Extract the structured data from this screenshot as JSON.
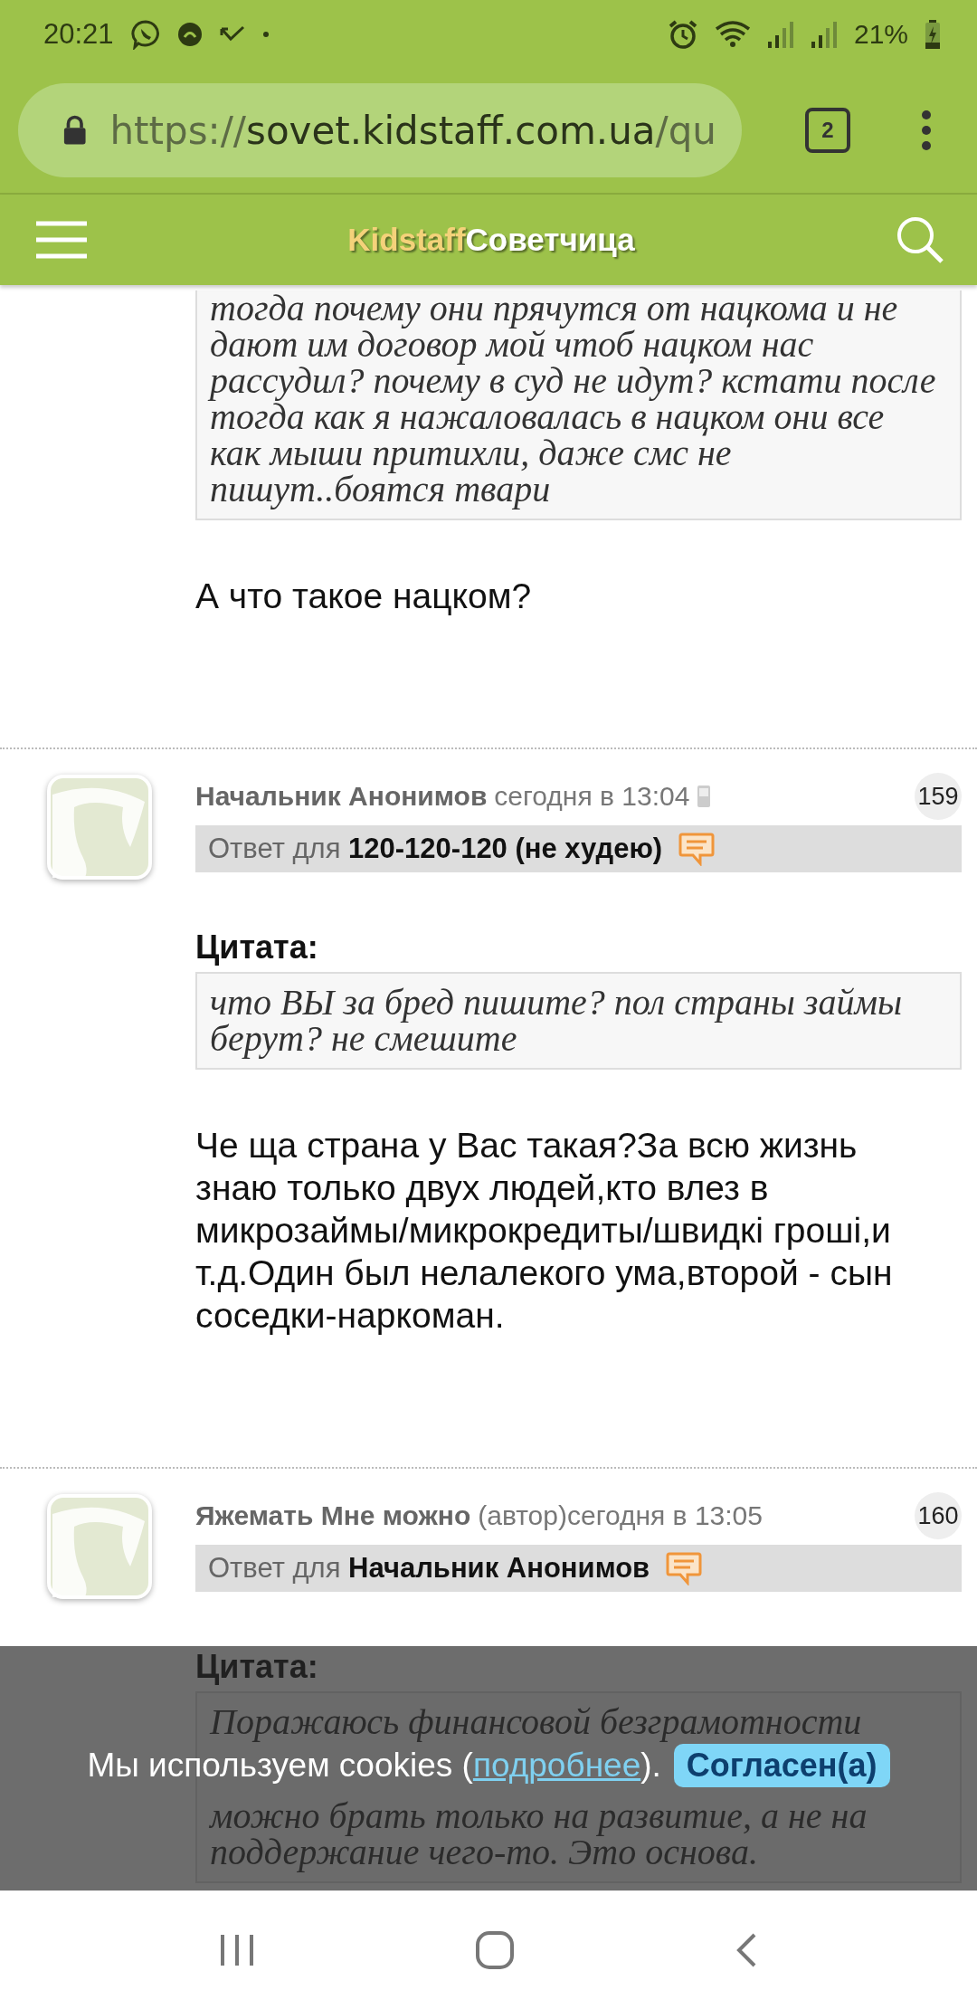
{
  "status_bar": {
    "time": "20:21",
    "battery": "21%"
  },
  "browser": {
    "url_scheme": "https://",
    "url_host": "sovet.kidstaff.com.ua",
    "url_path": "/qu",
    "tab_count": "2"
  },
  "header": {
    "logo_brand": "Kidstaff",
    "logo_title": "Советчица"
  },
  "posts": [
    {
      "kind": "continuation",
      "quote_blocks": [
        [
          "тогда почему они прячутся от нацкома и не",
          "дают им договор мой чтоб нацком нас",
          "рассудил? почему в суд не идут? кстати после",
          "тогда как я нажаловалась в нацком они все",
          "как мыши притихли, даже смс не",
          "пишут..боятся твари"
        ]
      ],
      "body_lines": [
        "А что такое нацком?"
      ]
    },
    {
      "kind": "post",
      "author": "Начальник Анонимов",
      "date": "сегодня в 13:04",
      "mobile": true,
      "number": "159",
      "reply_prefix": "Ответ для",
      "reply_to": "120-120-120 (не худею)",
      "quote_label": "Цитата:",
      "quote_blocks": [
        [
          "что ВЫ за бред пишите? пол страны займы",
          "берут? не смешите"
        ]
      ],
      "body_lines": [
        "Че ща страна у Вас такая?За всю жизнь",
        "знаю только двух людей,кто влез в",
        "микрозаймы/микрокредиты/швидкі гроші,и",
        "т.д.Один был нелалекого ума,второй - сын",
        "соседки-наркоман."
      ]
    },
    {
      "kind": "post",
      "author": "Яжемать Мне можно",
      "author_note": "(автор)",
      "date": "сегодня в 13:05",
      "mobile": false,
      "number": "160",
      "reply_prefix": "Ответ для",
      "reply_to": "Начальник Анонимов",
      "quote_label": "Цитата:",
      "quote_blocks": [
        [
          "Поражаюсь финансовой безграмотности"
        ],
        [
          "можно брать только на развитие, а не на",
          "поддержание чего-то. Это основа."
        ]
      ]
    }
  ],
  "cookie_banner": {
    "text_before": "Мы используем cookies (",
    "link": "подробнее",
    "text_after": ").",
    "button": "Согласен(а)"
  }
}
